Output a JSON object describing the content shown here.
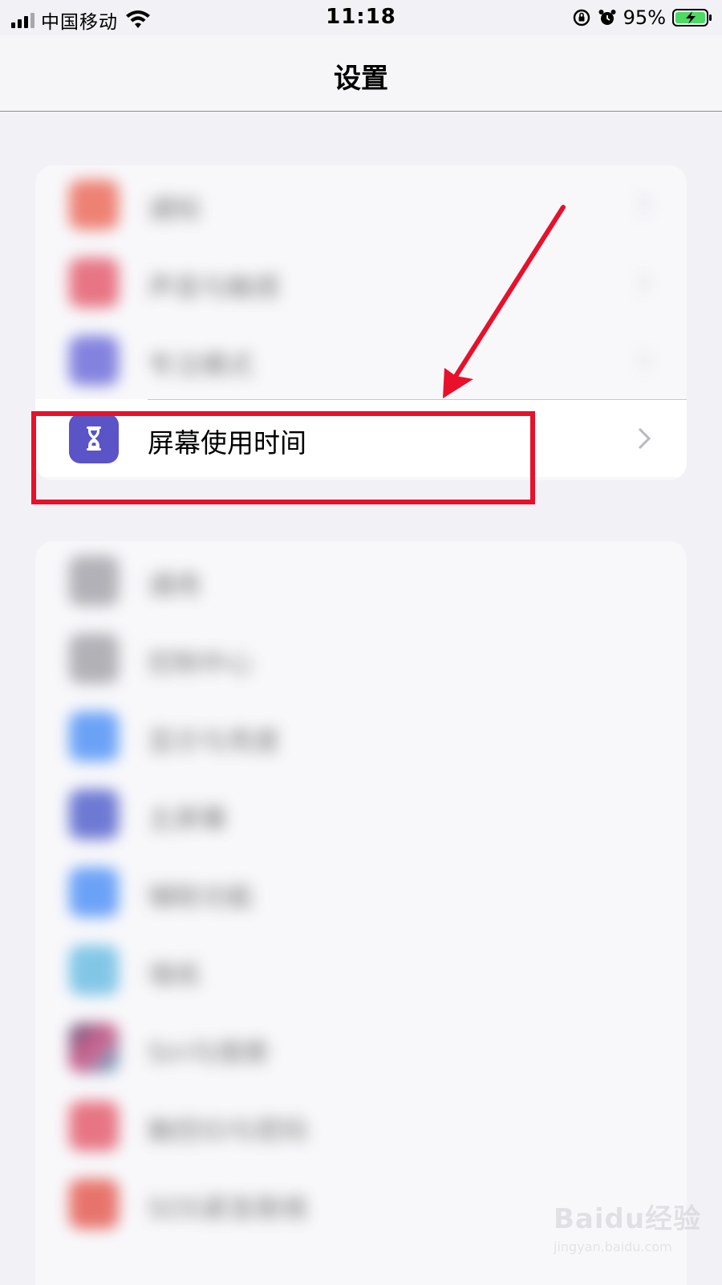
{
  "status_bar": {
    "carrier": "中国移动",
    "time": "11:18",
    "battery_percent": "95%",
    "icons": [
      "signal-icon",
      "wifi-icon",
      "orientation-lock-icon",
      "alarm-icon",
      "battery-charging-icon"
    ]
  },
  "nav": {
    "title": "设置"
  },
  "group1": {
    "rows": [
      {
        "label": "通知",
        "icon": "notifications-icon",
        "color": "#ea5a47"
      },
      {
        "label": "声音与触感",
        "icon": "sounds-icon",
        "color": "#e24a5c"
      },
      {
        "label": "专注模式",
        "icon": "focus-icon",
        "color": "#5c5bd6"
      },
      {
        "label": "屏幕使用时间",
        "icon": "hourglass-icon",
        "color": "#5b54c7"
      }
    ]
  },
  "group2": {
    "rows": [
      {
        "label": "通用",
        "icon": "gear-icon",
        "color": "#9a9aa0"
      },
      {
        "label": "控制中心",
        "icon": "control-center-icon",
        "color": "#9a9aa0"
      },
      {
        "label": "显示与亮度",
        "icon": "display-icon",
        "color": "#3d86f5"
      },
      {
        "label": "主屏幕",
        "icon": "home-screen-icon",
        "color": "#3f4fc6"
      },
      {
        "label": "辅助功能",
        "icon": "accessibility-icon",
        "color": "#3d86f5"
      },
      {
        "label": "墙纸",
        "icon": "wallpaper-icon",
        "color": "#5bb6e0"
      },
      {
        "label": "Siri与搜索",
        "icon": "siri-icon",
        "color": "#2a2a55"
      },
      {
        "label": "触控ID与密码",
        "icon": "touch-id-icon",
        "color": "#e24a5c"
      },
      {
        "label": "SOS紧急联络",
        "icon": "sos-icon",
        "color": "#e2493d"
      }
    ]
  },
  "annotation": {
    "highlight_color": "#e8102a"
  },
  "watermark": {
    "logo": "Baidu经验",
    "sub": "jingyan.baidu.com"
  }
}
